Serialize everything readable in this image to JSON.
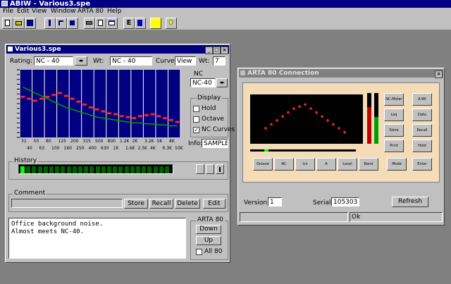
{
  "app": {
    "title": "ABIW - Various3.spe"
  },
  "menu": [
    {
      "label": "File"
    },
    {
      "label": "Edit"
    },
    {
      "label": "View"
    },
    {
      "label": "Window"
    },
    {
      "label": "ARTA 80"
    },
    {
      "label": "Help"
    }
  ],
  "toolbar": {
    "buttons": [
      {
        "name": "new-doc-icon"
      },
      {
        "name": "open-folder-icon"
      },
      {
        "name": "save-icon"
      },
      {
        "name": "tuning-fork-icon"
      },
      {
        "name": "undo-arrow-icon"
      },
      {
        "name": "speaker-icon"
      },
      {
        "name": "printer-icon"
      },
      {
        "name": "copy-icon"
      },
      {
        "name": "window-icon"
      },
      {
        "name": "e-icon"
      },
      {
        "name": "info-icon"
      },
      {
        "name": "pencil-icon"
      },
      {
        "name": "lightbulb-icon"
      }
    ]
  },
  "main_window": {
    "title": "Various3.spe",
    "rating_label": "Rating:",
    "rating_value": "NC - 40",
    "weight_label": "Wt:",
    "weight_value": "NC - 40",
    "curve_label": "Curve:",
    "curve_value": "View",
    "wt_label": "Wt:",
    "wt_value": "7",
    "nc_group_label": "NC",
    "nc_value": "NC-40",
    "display_group_label": "Display",
    "checks": [
      {
        "label": "Hold",
        "checked": false
      },
      {
        "label": "Octave",
        "checked": false
      },
      {
        "label": "NC Curves",
        "checked": true
      }
    ],
    "info_label": "Info:",
    "info_value": "SAMPLE",
    "x_labels_top": [
      "31",
      "50",
      "80",
      "125",
      "200",
      "315",
      "500",
      "800",
      "1.2K",
      "2K",
      "3.2K",
      "5K",
      "8K"
    ],
    "x_labels_bottom": [
      "40",
      "63",
      "100",
      "160",
      "250",
      "400",
      "630",
      "1K",
      "1.6K",
      "2.5K",
      "4K",
      "6.3K",
      "10K"
    ],
    "history_label": "History",
    "comment_label": "Comment",
    "buttons": {
      "store": "Store",
      "recall": "Recall",
      "delete": "Delete",
      "edit": "Edit"
    },
    "comment_text": "Office background noise.\nAlmost meets NC-40.",
    "arta_group": "ARTA 80",
    "arta_download": "Down",
    "arta_up": "Up",
    "all_label": "All 80"
  },
  "chart_data": {
    "type": "line",
    "categories": [
      "31",
      "40",
      "50",
      "63",
      "80",
      "100",
      "125",
      "160",
      "200",
      "250",
      "315",
      "400",
      "500",
      "630",
      "800",
      "1K",
      "1.2K",
      "1.6K",
      "2K",
      "2.5K",
      "3.2K",
      "4K",
      "5K",
      "6.3K",
      "8K",
      "10K"
    ],
    "series": [
      {
        "values": [
          62,
          60,
          58,
          60,
          62,
          64,
          66,
          63,
          60,
          57,
          54,
          51,
          49,
          47,
          45,
          44,
          42,
          41,
          40,
          42,
          43,
          44,
          42,
          40,
          38,
          36
        ]
      },
      {
        "values": [
          72,
          69,
          66,
          63,
          60,
          57,
          54,
          51,
          49,
          47,
          45,
          43,
          41,
          40,
          39,
          38,
          37,
          36,
          35,
          35,
          34,
          34,
          33,
          33,
          32,
          32
        ]
      }
    ],
    "ylim": [
      20,
      90
    ],
    "grid": true,
    "colors": {
      "bars": "#ff2020",
      "curve": "#00a000",
      "background": "#000080"
    }
  },
  "conn_window": {
    "title": "ARTA 80 Connection",
    "version_label": "Version",
    "version_value": "1",
    "serial_label": "Serial",
    "serial_value": "105303",
    "refresh_label": "Refresh",
    "status_text": "Ok",
    "device": {
      "screen_dots": [
        10,
        14,
        18,
        22,
        26,
        30,
        32,
        34,
        30,
        26,
        22,
        18,
        14,
        10,
        6
      ],
      "labels": [
        "NC-Meter",
        "A-Wt",
        "Leq",
        "Data",
        "Store",
        "Recall",
        "Print",
        "Hold",
        "Octave",
        "NC",
        "Lin",
        "A",
        "Level",
        "Band",
        "Mode",
        "Enter"
      ]
    }
  }
}
